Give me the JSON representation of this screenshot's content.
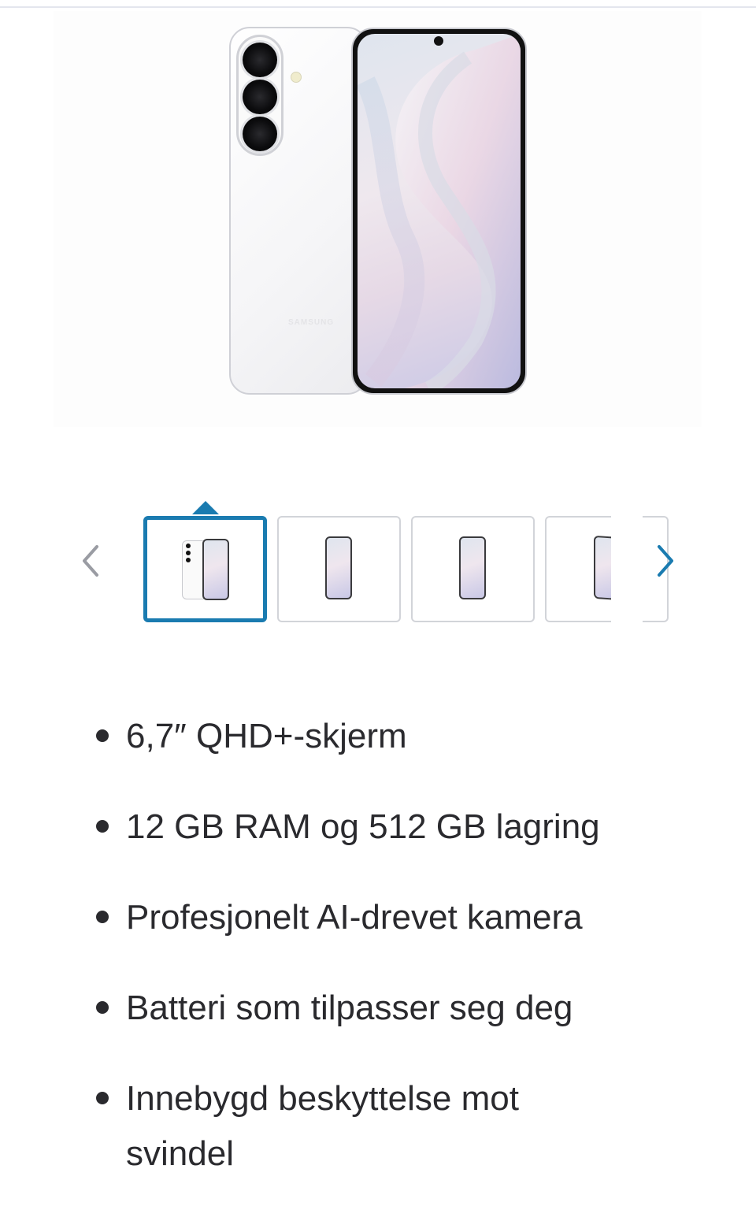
{
  "hero": {
    "brand_text": "SAMSUNG"
  },
  "gallery": {
    "prev_icon": "chevron-left-icon",
    "next_icon": "chevron-right-icon",
    "thumbnails": [
      {
        "view": "back-and-front",
        "active": true
      },
      {
        "view": "front"
      },
      {
        "view": "front"
      },
      {
        "view": "front-angled"
      }
    ],
    "active_color": "#1a7bb0"
  },
  "features": {
    "items": [
      "6,7″ QHD+-skjerm",
      "12 GB RAM og 512 GB lagring",
      "Profesjonelt AI-drevet kamera",
      "Batteri som tilpasser seg deg",
      "Innebygd beskyttelse mot svindel"
    ]
  }
}
